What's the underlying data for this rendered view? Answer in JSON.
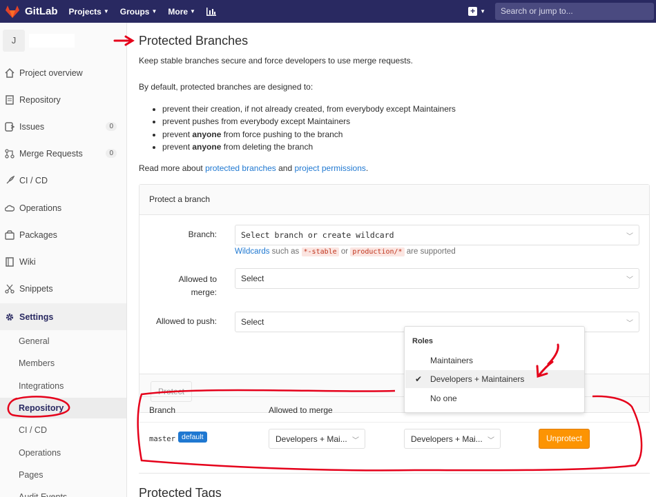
{
  "navbar": {
    "brand": "GitLab",
    "links": [
      "Projects",
      "Groups",
      "More"
    ],
    "search_placeholder": "Search or jump to..."
  },
  "sidebar": {
    "project_initial": "J",
    "items": [
      {
        "label": "Project overview",
        "icon": "home-icon"
      },
      {
        "label": "Repository",
        "icon": "doc-icon"
      },
      {
        "label": "Issues",
        "icon": "issues-icon",
        "badge": "0"
      },
      {
        "label": "Merge Requests",
        "icon": "merge-icon",
        "badge": "0"
      },
      {
        "label": "CI / CD",
        "icon": "rocket-icon"
      },
      {
        "label": "Operations",
        "icon": "cloud-icon"
      },
      {
        "label": "Packages",
        "icon": "package-icon"
      },
      {
        "label": "Wiki",
        "icon": "book-icon"
      },
      {
        "label": "Snippets",
        "icon": "scissors-icon"
      },
      {
        "label": "Settings",
        "icon": "gear-icon"
      }
    ],
    "settings_sub": [
      "General",
      "Members",
      "Integrations",
      "Repository",
      "CI / CD",
      "Operations",
      "Pages",
      "Audit Events"
    ]
  },
  "main": {
    "title": "Protected Branches",
    "intro": "Keep stable branches secure and force developers to use merge requests.",
    "default_intro": "By default, protected branches are designed to:",
    "bullets": [
      {
        "pre": "prevent their creation, if not already created, from everybody except Maintainers",
        "bold": "",
        "post": ""
      },
      {
        "pre": "prevent pushes from everybody except Maintainers",
        "bold": "",
        "post": ""
      },
      {
        "pre": "prevent ",
        "bold": "anyone",
        "post": " from force pushing to the branch"
      },
      {
        "pre": "prevent ",
        "bold": "anyone",
        "post": " from deleting the branch"
      }
    ],
    "read_more": {
      "pre": "Read more about ",
      "link1": "protected branches",
      "mid": " and ",
      "link2": "project permissions",
      "post": "."
    },
    "panel": {
      "title": "Protect a branch",
      "branch_label": "Branch:",
      "branch_placeholder": "Select branch or create wildcard",
      "help": {
        "link": "Wildcards",
        "t1": " such as ",
        "code1": "*-stable",
        "t2": " or ",
        "code2": "production/*",
        "t3": " are supported"
      },
      "merge_label_1": "Allowed to",
      "merge_label_2": "merge:",
      "merge_value": "Select",
      "push_label": "Allowed to push:",
      "push_value": "Select",
      "protect_button": "Protect"
    },
    "table": {
      "headers": [
        "Branch",
        "Allowed to merge"
      ],
      "row": {
        "branch": "master",
        "badge": "default",
        "merge": "Developers + Mai...",
        "push": "Developers + Mai...",
        "unprotect": "Unprotect"
      }
    },
    "next_title": "Protected Tags"
  },
  "dropdown": {
    "header": "Roles",
    "items": [
      "Maintainers",
      "Developers + Maintainers",
      "No one"
    ],
    "selected": "Developers + Maintainers"
  },
  "colors": {
    "navbar": "#292961",
    "link": "#1f78d1",
    "warning": "#fc9403",
    "annotation": "#e5001a"
  }
}
